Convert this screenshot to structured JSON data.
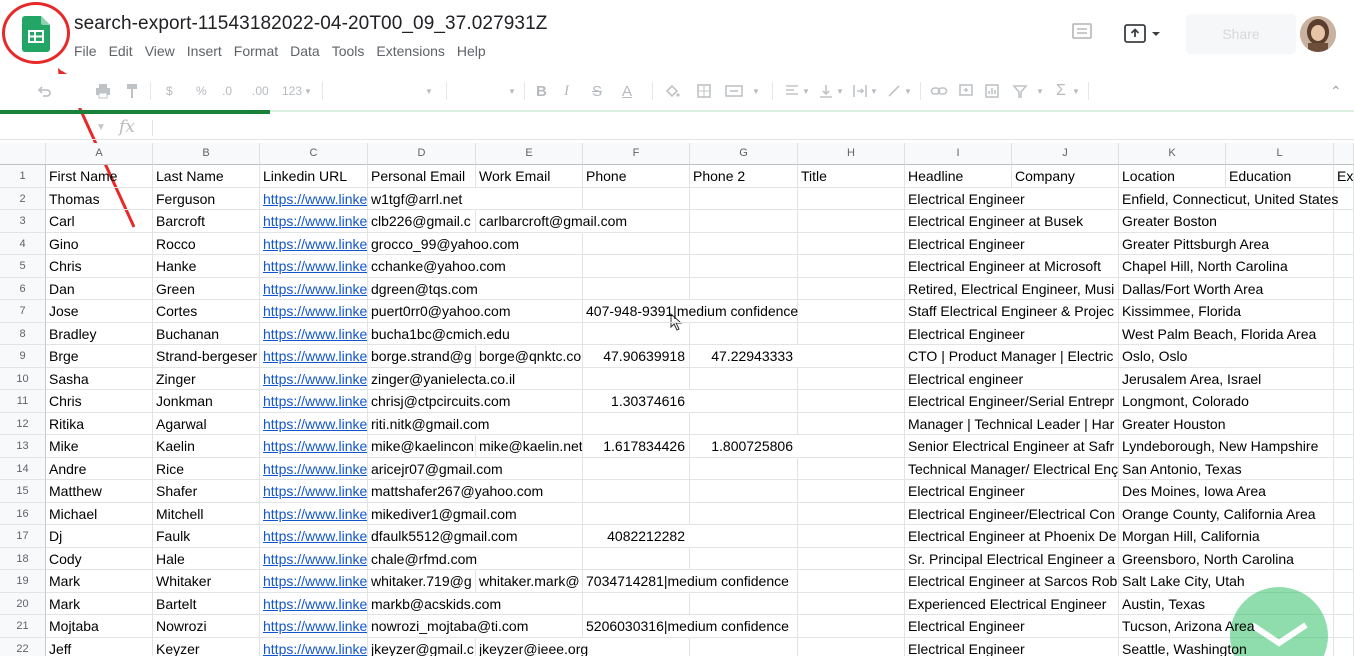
{
  "app": {
    "doc_title": "search-export-11543182022-04-20T00_09_37.027931Z",
    "menu": [
      "File",
      "Edit",
      "View",
      "Insert",
      "Format",
      "Data",
      "Tools",
      "Extensions",
      "Help"
    ],
    "share_label": "Share",
    "icons": {
      "logo": "google-sheets-icon",
      "comment": "comment-history-icon",
      "present": "present-icon",
      "avatar": "user-avatar"
    },
    "colors": {
      "sheets_green": "#188038",
      "link": "#1155cc",
      "annotation_red": "#e8292a"
    }
  },
  "toolbar": {
    "currency": "$",
    "percent": "%",
    "dec_less": ".0",
    "dec_more": ".00",
    "more_formats": "123",
    "bold": "B",
    "italic": "I",
    "strike": "S",
    "text_color": "A"
  },
  "formula": {
    "fx_label": "fx"
  },
  "grid": {
    "columns": [
      "A",
      "B",
      "C",
      "D",
      "E",
      "F",
      "G",
      "H",
      "I",
      "J",
      "K",
      "L"
    ],
    "rows": [
      [
        "First Name",
        "Last Name",
        "Linkedin URL",
        "Personal Email",
        "Work Email",
        "Phone",
        "Phone 2",
        "Title",
        "Headline",
        "Company",
        "Location",
        "Education",
        "Ex"
      ],
      [
        "Thomas",
        "Ferguson",
        "https://www.linke",
        "w1tgf@arrl.net",
        "",
        "",
        "",
        "",
        "Electrical Engineer",
        "",
        "Enfield, Connecticut, United States",
        "",
        ""
      ],
      [
        "Carl",
        "Barcroft",
        "https://www.linke",
        "clb226@gmail.c",
        "carlbarcroft@gmail.com",
        "",
        "",
        "",
        "Electrical Engineer at Busek",
        "",
        "Greater Boston",
        "",
        ""
      ],
      [
        "Gino",
        "Rocco",
        "https://www.linke",
        "grocco_99@yahoo.com",
        "",
        "",
        "",
        "",
        "Electrical Engineer",
        "",
        "Greater Pittsburgh Area",
        "",
        ""
      ],
      [
        "Chris",
        "Hanke",
        "https://www.linke",
        "cchanke@yahoo.com",
        "",
        "",
        "",
        "",
        "Electrical Engineer at Microsoft",
        "",
        "Chapel Hill, North Carolina",
        "",
        ""
      ],
      [
        "Dan",
        "Green",
        "https://www.linke",
        "dgreen@tqs.com",
        "",
        "",
        "",
        "",
        "Retired, Electrical Engineer, Musi",
        "",
        "Dallas/Fort Worth Area",
        "",
        ""
      ],
      [
        "Jose",
        "Cortes",
        "https://www.linke",
        "puert0rr0@yahoo.com",
        "",
        "407-948-9391|medium confidence",
        "",
        "",
        "Staff Electrical Engineer & Projec",
        "",
        "Kissimmee, Florida",
        "",
        ""
      ],
      [
        "Bradley",
        "Buchanan",
        "https://www.linke",
        "bucha1bc@cmich.edu",
        "",
        "",
        "",
        "",
        "Electrical Engineer",
        "",
        "West Palm Beach, Florida Area",
        "",
        ""
      ],
      [
        "Brge",
        "Strand-bergeser",
        "https://www.linke",
        "borge.strand@g",
        "borge@qnktc.co",
        "47.90639918",
        "47.22943333",
        "",
        "CTO | Product Manager | Electric",
        "",
        "Oslo, Oslo",
        "",
        ""
      ],
      [
        "Sasha",
        "Zinger",
        "https://www.linke",
        "zinger@yanielecta.co.il",
        "",
        "",
        "",
        "",
        "Electrical engineer",
        "",
        "Jerusalem Area, Israel",
        "",
        ""
      ],
      [
        "Chris",
        "Jonkman",
        "https://www.linke",
        "chrisj@ctpcircuits.com",
        "",
        "1.30374616",
        "",
        "",
        "Electrical Engineer/Serial Entrepr",
        "",
        "Longmont, Colorado",
        "",
        ""
      ],
      [
        "Ritika",
        "Agarwal",
        "https://www.linke",
        "riti.nitk@gmail.com",
        "",
        "",
        "",
        "",
        "Manager | Technical Leader | Har",
        "",
        "Greater Houston",
        "",
        ""
      ],
      [
        "Mike",
        "Kaelin",
        "https://www.linke",
        "mike@kaelincon",
        "mike@kaelin.net",
        "1.617834426",
        "1.800725806",
        "",
        "Senior Electrical Engineer at Safr",
        "",
        "Lyndeborough, New Hampshire",
        "",
        ""
      ],
      [
        "Andre",
        "Rice",
        "https://www.linke",
        "aricejr07@gmail.com",
        "",
        "",
        "",
        "",
        "Technical Manager/ Electrical Enç",
        "",
        "San Antonio, Texas",
        "",
        ""
      ],
      [
        "Matthew",
        "Shafer",
        "https://www.linke",
        "mattshafer267@yahoo.com",
        "",
        "",
        "",
        "",
        "Electrical Engineer",
        "",
        "Des Moines, Iowa Area",
        "",
        ""
      ],
      [
        "Michael",
        "Mitchell",
        "https://www.linke",
        "mikediver1@gmail.com",
        "",
        "",
        "",
        "",
        "Electrical Engineer/Electrical Con",
        "",
        "Orange County, California Area",
        "",
        ""
      ],
      [
        "Dj",
        "Faulk",
        "https://www.linke",
        "dfaulk5512@gmail.com",
        "",
        "4082212282",
        "",
        "",
        "Electrical Engineer at Phoenix De",
        "",
        "Morgan Hill, California",
        "",
        ""
      ],
      [
        "Cody",
        "Hale",
        "https://www.linke",
        "chale@rfmd.com",
        "",
        "",
        "",
        "",
        "Sr. Principal Electrical Engineer a",
        "",
        "Greensboro, North Carolina",
        "",
        ""
      ],
      [
        "Mark",
        "Whitaker",
        "https://www.linke",
        "whitaker.719@g",
        "whitaker.mark@",
        "7034714281|medium confidence",
        "",
        "",
        "Electrical Engineer at Sarcos Rob",
        "",
        "Salt Lake City, Utah",
        "",
        ""
      ],
      [
        "Mark",
        "Bartelt",
        "https://www.linke",
        "markb@acskids.com",
        "",
        "",
        "",
        "",
        "Experienced Electrical Engineer",
        "",
        "Austin, Texas",
        "",
        ""
      ],
      [
        "Mojtaba",
        "Nowrozi",
        "https://www.linke",
        "nowrozi_mojtaba@ti.com",
        "",
        "5206030316|medium confidence",
        "",
        "",
        "Electrical Engineer",
        "",
        "Tucson, Arizona Area",
        "",
        ""
      ],
      [
        "Jeff",
        "Keyzer",
        "https://www.linke",
        "jkeyzer@gmail.c",
        "jkeyzer@ieee.org",
        "",
        "",
        "",
        "Electrical Engineer",
        "",
        "Seattle, Washington",
        "",
        ""
      ]
    ]
  }
}
